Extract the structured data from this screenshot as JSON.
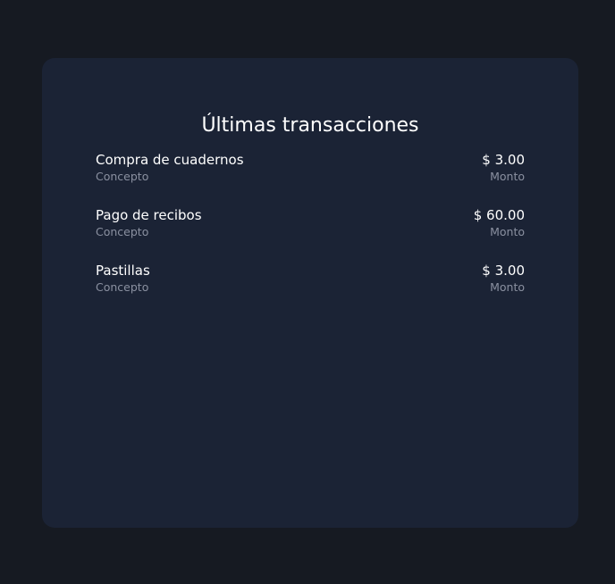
{
  "panel": {
    "title": "Últimas transacciones"
  },
  "transactions": [
    {
      "concept": "Compra de cuadernos",
      "concept_label": "Concepto",
      "amount": "$ 3.00",
      "amount_label": "Monto"
    },
    {
      "concept": "Pago de recibos",
      "concept_label": "Concepto",
      "amount": "$ 60.00",
      "amount_label": "Monto"
    },
    {
      "concept": "Pastillas",
      "concept_label": "Concepto",
      "amount": "$ 3.00",
      "amount_label": "Monto"
    }
  ],
  "colors": {
    "page_background": "#161a22",
    "card_background": "#1b2335",
    "primary_text": "#ffffff",
    "secondary_text": "#8a90a0"
  }
}
